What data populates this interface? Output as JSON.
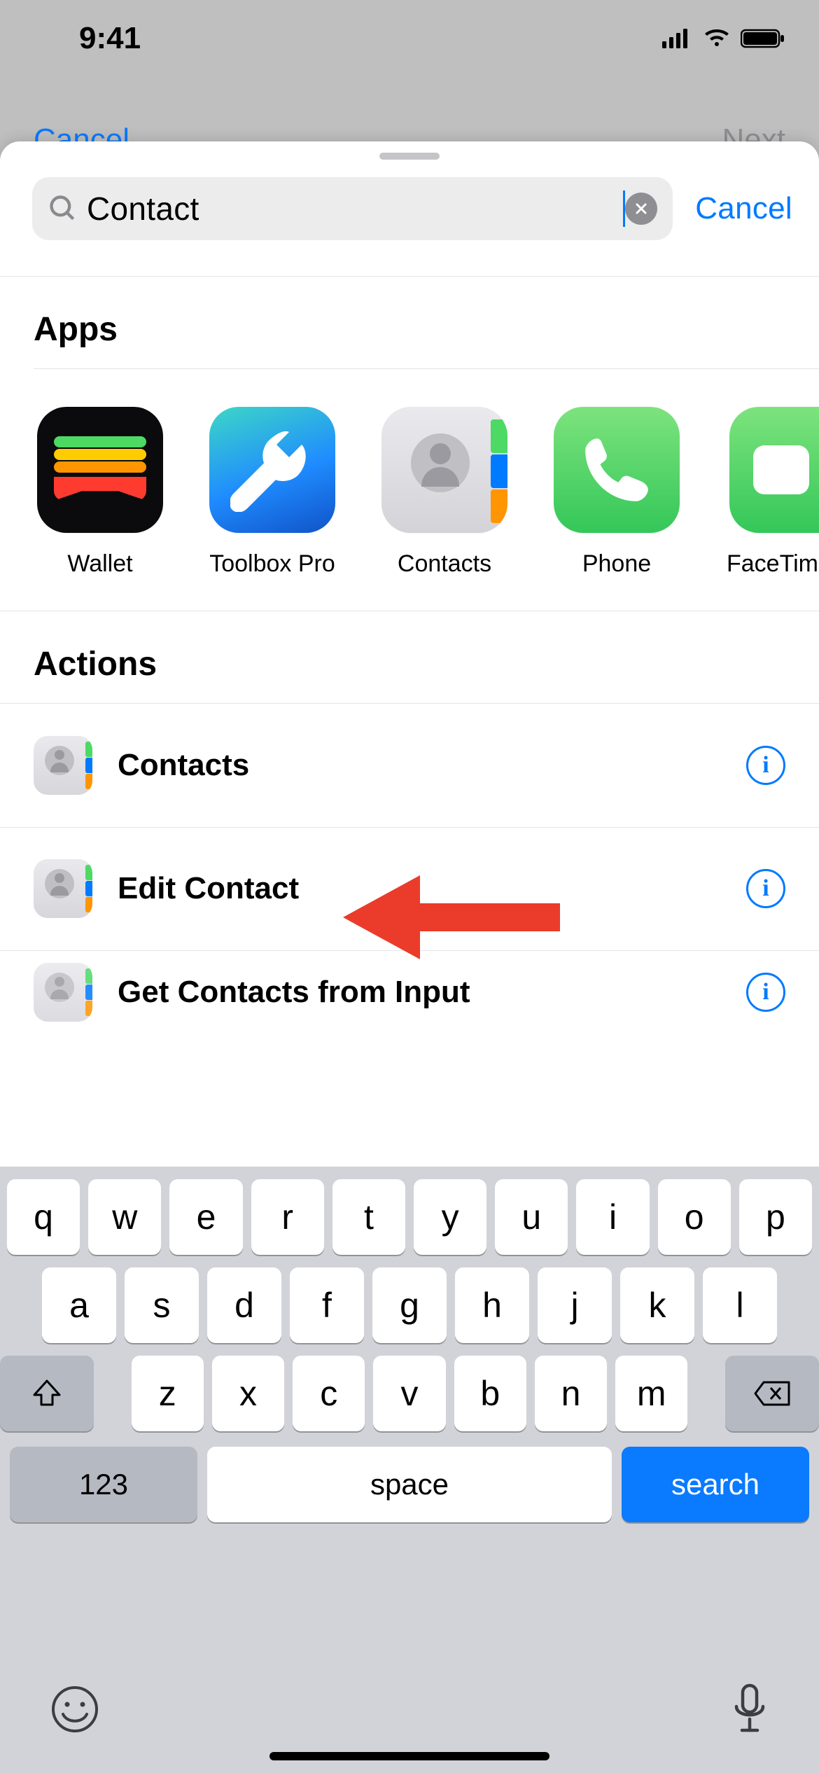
{
  "status": {
    "time": "9:41"
  },
  "bg_nav": {
    "cancel": "Cancel",
    "next": "Next"
  },
  "search": {
    "value": "Contact",
    "cancel": "Cancel"
  },
  "sections": {
    "apps": "Apps",
    "actions": "Actions"
  },
  "apps": [
    {
      "label": "Wallet",
      "icon": "wallet"
    },
    {
      "label": "Toolbox Pro",
      "icon": "toolbox"
    },
    {
      "label": "Contacts",
      "icon": "contacts"
    },
    {
      "label": "Phone",
      "icon": "phone"
    },
    {
      "label": "FaceTime",
      "icon": "facetime"
    }
  ],
  "actions": [
    {
      "title": "Contacts"
    },
    {
      "title": "Edit Contact"
    },
    {
      "title": "Get Contacts from Input"
    }
  ],
  "keyboard": {
    "row1": [
      "q",
      "w",
      "e",
      "r",
      "t",
      "y",
      "u",
      "i",
      "o",
      "p"
    ],
    "row2": [
      "a",
      "s",
      "d",
      "f",
      "g",
      "h",
      "j",
      "k",
      "l"
    ],
    "row3": [
      "z",
      "x",
      "c",
      "v",
      "b",
      "n",
      "m"
    ],
    "numbers": "123",
    "space": "space",
    "return": "search"
  },
  "annotation": {
    "arrow_target_index": 0
  }
}
